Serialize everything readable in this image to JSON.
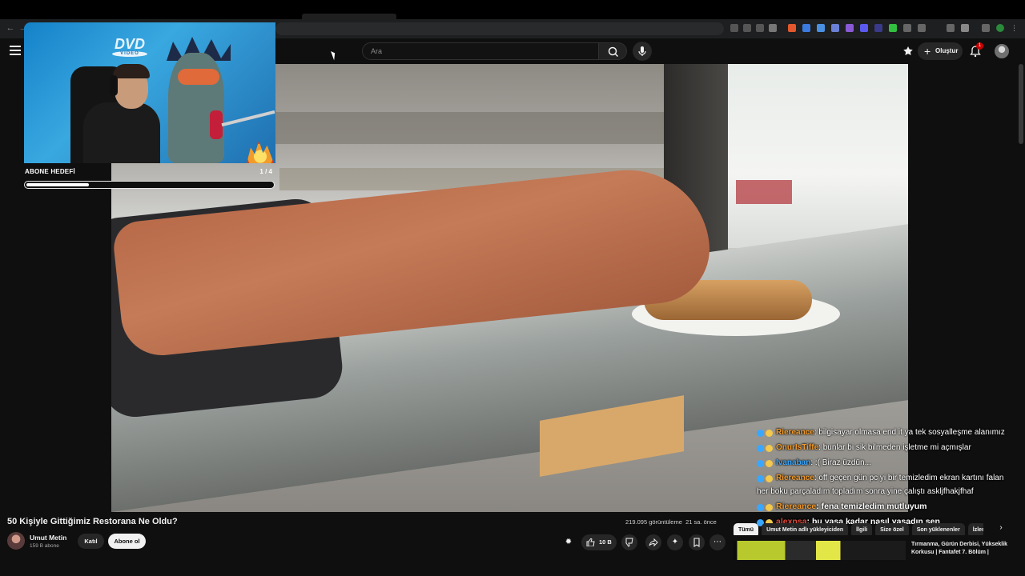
{
  "header": {
    "search_placeholder": "Ara",
    "create_label": "Oluştur",
    "notification_count": "1"
  },
  "overlay": {
    "cam_logo": "DVD",
    "cam_logo_sub": "VIDEO",
    "goal_label": "ABONE HEDEFİ",
    "goal_count": "1 / 4",
    "goal_progress": 0.25
  },
  "video": {
    "title": "50 Kişiyle Gittiğimiz Restorana Ne Oldu?",
    "views": "219.095 görüntüleme",
    "time_ago": "21 sa. önce"
  },
  "channel": {
    "name": "Umut Metin",
    "subscribers": "159 B abone",
    "join_label": "Katıl",
    "subscribe_label": "Abone ol"
  },
  "actions": {
    "like_count": "10 B"
  },
  "chat": [
    {
      "user": "Riereance",
      "user_color": "#f29b2b",
      "text": ": bilgisayar olmasa end it ya tek sosyalleşme alanımız",
      "big": false
    },
    {
      "user": "OnurIsTiffe",
      "user_color": "#f29b2b",
      "text": ": bunlar bi sik bilmeden işletme mi açmışlar",
      "big": false
    },
    {
      "user": "Ivanaban",
      "user_color": "#3aa7ff",
      "text": ": :( Biraz üzdün...",
      "big": false
    },
    {
      "user": "Riereance",
      "user_color": "#f29b2b",
      "text": ": off geçen gün pc yi bir temizledim ekran kartını falan her boku parçaladım topladım sonra yine çalıştı askljfhakjfhaf",
      "big": false
    },
    {
      "user": "Riereance",
      "user_color": "#f29b2b",
      "text": ": fena temizledim mutluyum",
      "big": true
    },
    {
      "user": "alexnsa",
      "user_color": "#e04a3a",
      "text": ": bu yaşa kadar nasıl yaşadın sen",
      "big": true
    }
  ],
  "chips": [
    "Tümü",
    "Umut Metin adlı yükleyiciden",
    "İlgili",
    "Size özel",
    "Son yüklenenler",
    "İzlenenler"
  ],
  "recommended": {
    "title": "Tırmanma, Gürün Derbisi, Yükseklik Korkusu | Fantafet 7. Bölüm |"
  },
  "colors": {
    "accent_red": "#cc0000",
    "background": "#0f0f0f"
  }
}
